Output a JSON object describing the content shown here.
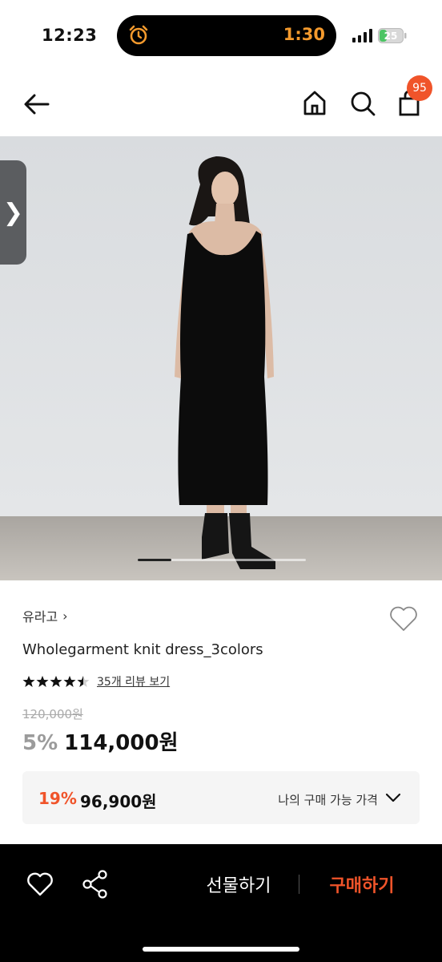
{
  "status_bar": {
    "time": "12:23",
    "timer": "1:30",
    "battery_level": "25",
    "icons": [
      "alarm-icon",
      "signal-icon",
      "battery-icon"
    ]
  },
  "nav": {
    "cart_count": "95",
    "icons": [
      "back-arrow-icon",
      "home-icon",
      "search-icon",
      "shopping-bag-icon"
    ]
  },
  "gallery": {
    "side_tab_glyph": "❯",
    "progress": 0.2
  },
  "product": {
    "brand": "유라고",
    "brand_chevron": "›",
    "name": "Wholegarment knit dress_3colors",
    "rating": 4.5,
    "review_link": "35개 리뷰 보기",
    "original_price": "120,000원",
    "discount": "5%",
    "sale_price": "114,000원"
  },
  "my_price": {
    "discount": "19%",
    "price": "96,900원",
    "label": "나의 구매 가능 가격"
  },
  "bottom_bar": {
    "gift_label": "선물하기",
    "buy_label": "구매하기"
  },
  "colors": {
    "accent": "#f0542a",
    "bottom_bar_bg": "#000000",
    "my_price_box_bg": "#f5f5f5"
  }
}
